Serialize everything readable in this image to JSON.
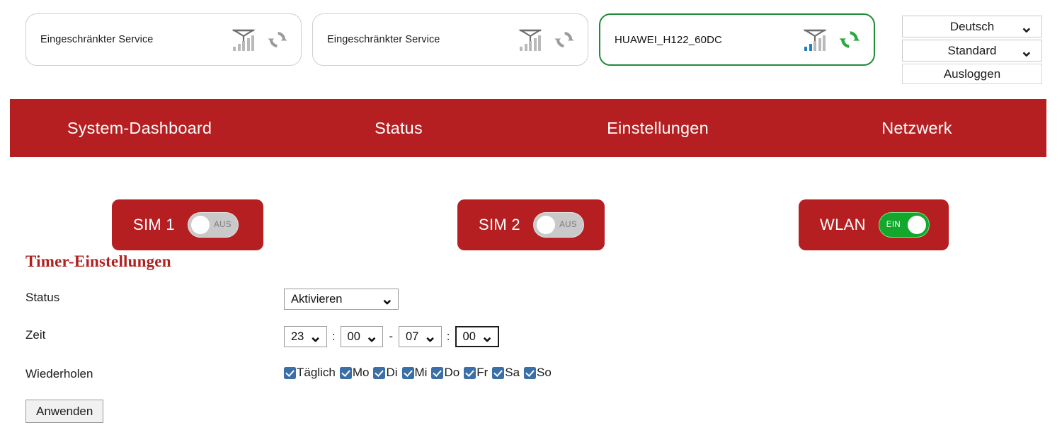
{
  "header": {
    "status_cards": [
      {
        "label": "Eingeschränkter Service",
        "signal_icon": "signal-bars-icon",
        "refresh_icon": "refresh-icon",
        "active": false,
        "signal_level": 0,
        "accent": "#b9b9b9"
      },
      {
        "label": "Eingeschränkter Service",
        "signal_icon": "signal-bars-icon",
        "refresh_icon": "refresh-icon",
        "active": false,
        "signal_level": 0,
        "accent": "#b9b9b9"
      },
      {
        "label": "HUAWEI_H122_60DC",
        "signal_icon": "signal-bars-icon",
        "refresh_icon": "refresh-icon",
        "active": true,
        "signal_level": 2,
        "accent": "#1f8c37"
      }
    ],
    "language_select": {
      "value": "Deutsch",
      "caret_icon": "chevron-down-icon"
    },
    "profile_select": {
      "value": "Standard",
      "caret_icon": "chevron-down-icon"
    },
    "logout_button": "Ausloggen"
  },
  "nav": {
    "background": "#b61f21",
    "items": [
      {
        "label": "System-Dashboard"
      },
      {
        "label": "Status"
      },
      {
        "label": "Einstellungen"
      },
      {
        "label": "Netzwerk"
      }
    ]
  },
  "toggles": [
    {
      "label": "SIM 1",
      "state_text": "AUS",
      "on": false
    },
    {
      "label": "SIM 2",
      "state_text": "AUS",
      "on": false
    },
    {
      "label": "WLAN",
      "state_text": "EIN",
      "on": true
    }
  ],
  "timer": {
    "title": "Timer-Einstellungen",
    "status_label": "Status",
    "status_value": "Aktivieren",
    "time_label": "Zeit",
    "time": {
      "start_hour": "23",
      "start_minute": "00",
      "end_hour": "07",
      "end_minute": "00",
      "separator": ":",
      "dash": "-"
    },
    "repeat_label": "Wiederholen",
    "repeat_options": [
      {
        "label": "Täglich",
        "checked": true
      },
      {
        "label": "Mo",
        "checked": true
      },
      {
        "label": "Di",
        "checked": true
      },
      {
        "label": "Mi",
        "checked": true
      },
      {
        "label": "Do",
        "checked": true
      },
      {
        "label": "Fr",
        "checked": true
      },
      {
        "label": "Sa",
        "checked": true
      },
      {
        "label": "So",
        "checked": true
      }
    ],
    "apply_button": "Anwenden",
    "title_color": "#b0201f"
  }
}
